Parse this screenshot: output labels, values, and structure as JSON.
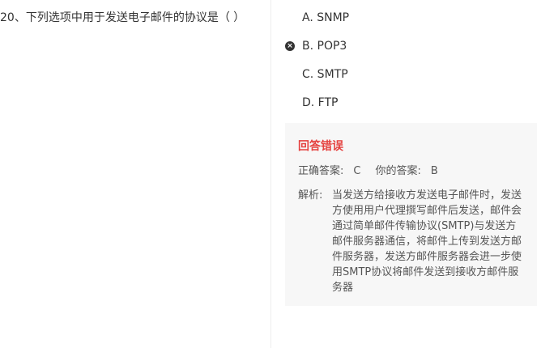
{
  "question": {
    "text": "20、下列选项中用于发送电子邮件的协议是（ ）"
  },
  "options": [
    {
      "label": "A. SNMP",
      "selected_wrong": false
    },
    {
      "label": "B. POP3",
      "selected_wrong": true
    },
    {
      "label": "C. SMTP",
      "selected_wrong": false
    },
    {
      "label": "D. FTP",
      "selected_wrong": false
    }
  ],
  "result": {
    "title": "回答错误",
    "correct_label": "正确答案:",
    "correct_value": "C",
    "yours_label": "你的答案:",
    "yours_value": "B",
    "analysis_label": "解析:",
    "analysis_text": "当发送方给接收方发送电子邮件时，发送方使用用户代理撰写邮件后发送，邮件会通过简单邮件传输协议(SMTP)与发送方邮件服务器通信，将邮件上传到发送方邮件服务器，发送方邮件服务器会进一步使用SMTP协议将邮件发送到接收方邮件服务器"
  },
  "icons": {
    "wrong": "close-circle-icon"
  },
  "colors": {
    "error": "#e5413f",
    "panel_bg": "#f7f7f7"
  }
}
